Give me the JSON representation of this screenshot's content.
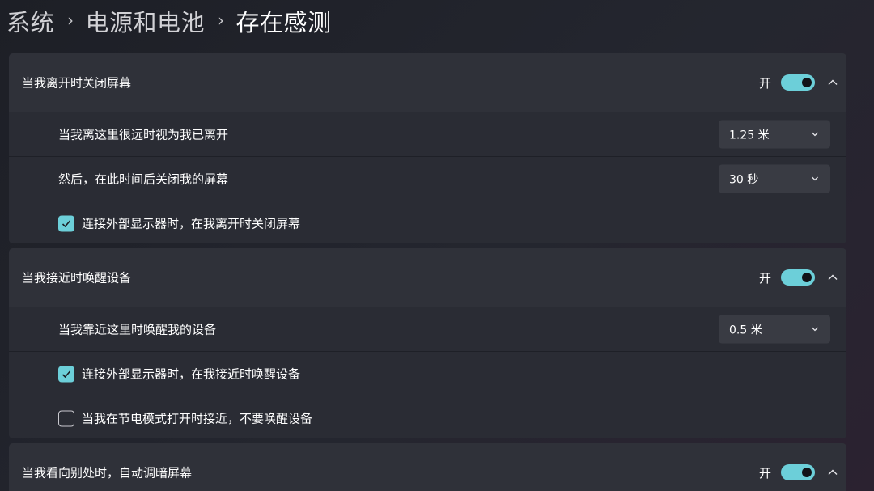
{
  "breadcrumb": {
    "items": [
      "系统",
      "电源和电池",
      "存在感测"
    ],
    "separator": "›"
  },
  "colors": {
    "accent": "#6ccfd9",
    "card_bg": "#2c2e36",
    "control_bg": "#393b43"
  },
  "sections": [
    {
      "title": "当我离开时关闭屏幕",
      "toggle_label": "开",
      "toggle_on": true,
      "rows": [
        {
          "type": "dropdown",
          "label": "当我离这里很远时视为我已离开",
          "value": "1.25 米"
        },
        {
          "type": "dropdown",
          "label": "然后，在此时间后关闭我的屏幕",
          "value": "30 秒"
        },
        {
          "type": "checkbox",
          "label": "连接外部显示器时，在我离开时关闭屏幕",
          "checked": true
        }
      ]
    },
    {
      "title": "当我接近时唤醒设备",
      "toggle_label": "开",
      "toggle_on": true,
      "rows": [
        {
          "type": "dropdown",
          "label": "当我靠近这里时唤醒我的设备",
          "value": "0.5 米"
        },
        {
          "type": "checkbox",
          "label": "连接外部显示器时，在我接近时唤醒设备",
          "checked": true
        },
        {
          "type": "checkbox",
          "label": "当我在节电模式打开时接近，不要唤醒设备",
          "checked": false
        }
      ]
    },
    {
      "title": "当我看向别处时，自动调暗屏幕",
      "toggle_label": "开",
      "toggle_on": true,
      "rows": []
    }
  ]
}
